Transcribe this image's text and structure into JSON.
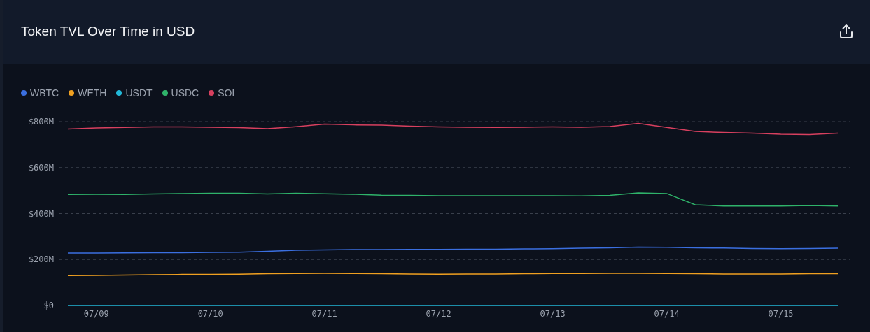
{
  "card": {
    "title": "Token TVL Over Time in USD",
    "chart_data": {
      "type": "line",
      "categories": [
        null,
        "07/09",
        null,
        null,
        null,
        "07/10",
        null,
        null,
        null,
        "07/11",
        null,
        null,
        null,
        "07/12",
        null,
        null,
        null,
        "07/13",
        null,
        null,
        null,
        "07/14",
        null,
        null,
        null,
        "07/15",
        null,
        null
      ],
      "ylim": [
        0,
        800
      ],
      "grid": true,
      "yticks": [
        {
          "value": 0,
          "label": "$0"
        },
        {
          "value": 200,
          "label": "$200M"
        },
        {
          "value": 400,
          "label": "$400M"
        },
        {
          "value": 600,
          "label": "$600M"
        },
        {
          "value": 800,
          "label": "$800M"
        }
      ],
      "series": [
        {
          "name": "WBTC",
          "color": "#3b6fe0",
          "values": [
            228,
            228,
            229,
            230,
            230,
            231,
            232,
            236,
            240,
            242,
            243,
            243,
            244,
            244,
            245,
            245,
            246,
            247,
            249,
            251,
            254,
            253,
            251,
            250,
            248,
            247,
            248,
            249
          ]
        },
        {
          "name": "WETH",
          "color": "#f0a020",
          "values": [
            130,
            131,
            132,
            134,
            135,
            135,
            136,
            138,
            139,
            140,
            139,
            138,
            137,
            136,
            137,
            137,
            138,
            139,
            139,
            140,
            140,
            139,
            138,
            137,
            137,
            137,
            138,
            138
          ]
        },
        {
          "name": "USDT",
          "color": "#22b8d8",
          "values": [
            0,
            0,
            0,
            0,
            0,
            0,
            0,
            0,
            0,
            0,
            0,
            0,
            0,
            0,
            0,
            0,
            0,
            0,
            0,
            0,
            0,
            0,
            0,
            0,
            0,
            0,
            0,
            0
          ]
        },
        {
          "name": "USDC",
          "color": "#2fb36a",
          "values": [
            483,
            484,
            483,
            485,
            487,
            488,
            488,
            485,
            488,
            486,
            484,
            480,
            479,
            478,
            478,
            478,
            478,
            478,
            477,
            479,
            490,
            487,
            438,
            433,
            433,
            433,
            435,
            433
          ]
        },
        {
          "name": "SOL",
          "color": "#d8405f",
          "values": [
            768,
            773,
            775,
            777,
            777,
            776,
            774,
            770,
            778,
            789,
            786,
            785,
            780,
            777,
            776,
            775,
            776,
            777,
            776,
            779,
            792,
            775,
            757,
            753,
            750,
            745,
            744,
            750
          ]
        }
      ]
    }
  }
}
